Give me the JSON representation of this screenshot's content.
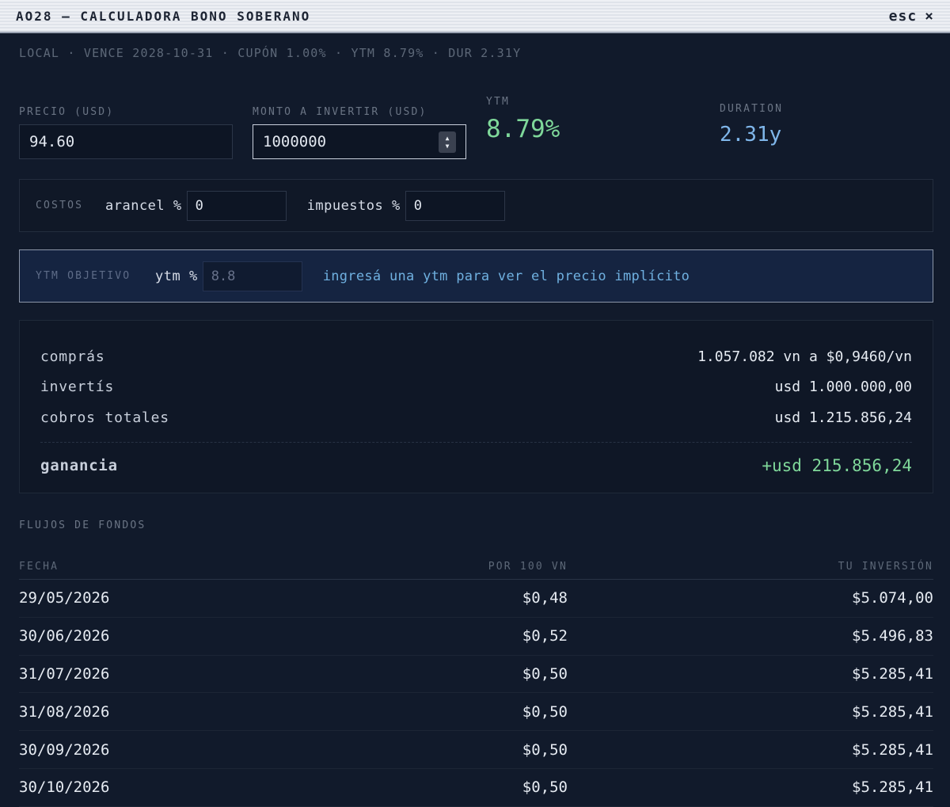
{
  "window": {
    "title": "AO28 — CALCULADORA BONO SOBERANO",
    "close_label": "esc",
    "close_glyph": "×"
  },
  "subtitle": "LOCAL · VENCE 2028-10-31 · CUPÓN 1.00% · YTM 8.79% · DUR 2.31Y",
  "inputs": {
    "precio_label": "PRECIO (USD)",
    "precio_value": "94.60",
    "monto_label": "MONTO A INVERTIR (USD)",
    "monto_value": "1000000"
  },
  "stats": {
    "ytm_label": "YTM",
    "ytm_value": "8.79%",
    "duration_label": "DURATION",
    "duration_value": "2.31y"
  },
  "costos": {
    "label": "COSTOS",
    "arancel_label": "arancel %",
    "arancel_value": "0",
    "impuestos_label": "impuestos %",
    "impuestos_value": "0"
  },
  "ytm_objetivo": {
    "label": "YTM OBJETIVO",
    "input_label": "ytm %",
    "placeholder": "8.8",
    "hint": "ingresá una ytm para ver el precio implícito"
  },
  "summary": {
    "rows": [
      {
        "k": "comprás",
        "v": "1.057.082 vn a $0,9460/vn"
      },
      {
        "k": "invertís",
        "v": "usd 1.000.000,00"
      },
      {
        "k": "cobros totales",
        "v": "usd 1.215.856,24"
      }
    ],
    "gain_label": "ganancia",
    "gain_value": "+usd 215.856,24"
  },
  "flows": {
    "title": "FLUJOS DE FONDOS",
    "headers": [
      "FECHA",
      "POR 100 VN",
      "TU INVERSIÓN"
    ],
    "rows": [
      [
        "29/05/2026",
        "$0,48",
        "$5.074,00"
      ],
      [
        "30/06/2026",
        "$0,52",
        "$5.496,83"
      ],
      [
        "31/07/2026",
        "$0,50",
        "$5.285,41"
      ],
      [
        "31/08/2026",
        "$0,50",
        "$5.285,41"
      ],
      [
        "30/09/2026",
        "$0,50",
        "$5.285,41"
      ],
      [
        "30/10/2026",
        "$0,50",
        "$5.285,41"
      ]
    ]
  },
  "colors": {
    "accent_green": "#7fd89a",
    "accent_blue": "#7fb6ea",
    "background": "#111a2b"
  }
}
